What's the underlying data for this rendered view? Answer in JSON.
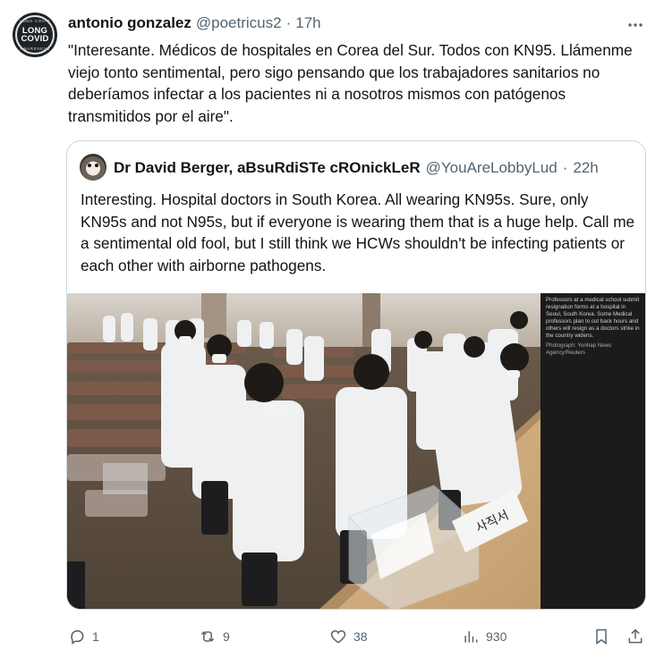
{
  "tweet": {
    "author_name": "antonio gonzalez",
    "author_handle": "@poetricus2",
    "separator": "·",
    "time": "17h",
    "text": "\"Interesante. Médicos de hospitales en Corea del Sur. Todos con KN95. Llámenme viejo tonto sentimental, pero sigo pensando que los trabajadores sanitarios no deberíamos infectar a los pacientes ni a nosotros mismos con patógenos transmitidos por el aire\".",
    "avatar_text_top": "LONG COVID",
    "avatar_text_bottom": "AWARENESS",
    "avatar_line1": "LONG",
    "avatar_line2": "COVID"
  },
  "quote": {
    "author_name": "Dr David Berger, aBsuRdiSTe cROnickLeR",
    "author_handle": "@YouAreLobbyLud",
    "separator": "·",
    "time": "22h",
    "text": "Interesting. Hospital doctors in South Korea. All wearing KN95s. Sure, only KN95s and not N95s, but if everyone is wearing them that is a huge help. Call me a sentimental old fool, but I still think we HCWs shouldn't be infecting patients or each other with airborne pathogens.",
    "image_caption": "Professors at a medical school submit resignation forms at a hospital in Seoul, South Korea. Some Medical professors plan to cut back hours and others will resign as a doctors strike in the country widens.",
    "image_credit": "Photograph: Yonhap News Agency/Reuters",
    "ballot_box_text": "사직서"
  },
  "actions": {
    "replies": "1",
    "reposts": "9",
    "likes": "38",
    "views": "930"
  },
  "colors": {
    "text_primary": "#0f1419",
    "text_secondary": "#536471",
    "border": "#cfd9de"
  },
  "icons": [
    "more-icon",
    "reply-icon",
    "repost-icon",
    "like-icon",
    "views-icon",
    "bookmark-icon",
    "share-icon"
  ]
}
